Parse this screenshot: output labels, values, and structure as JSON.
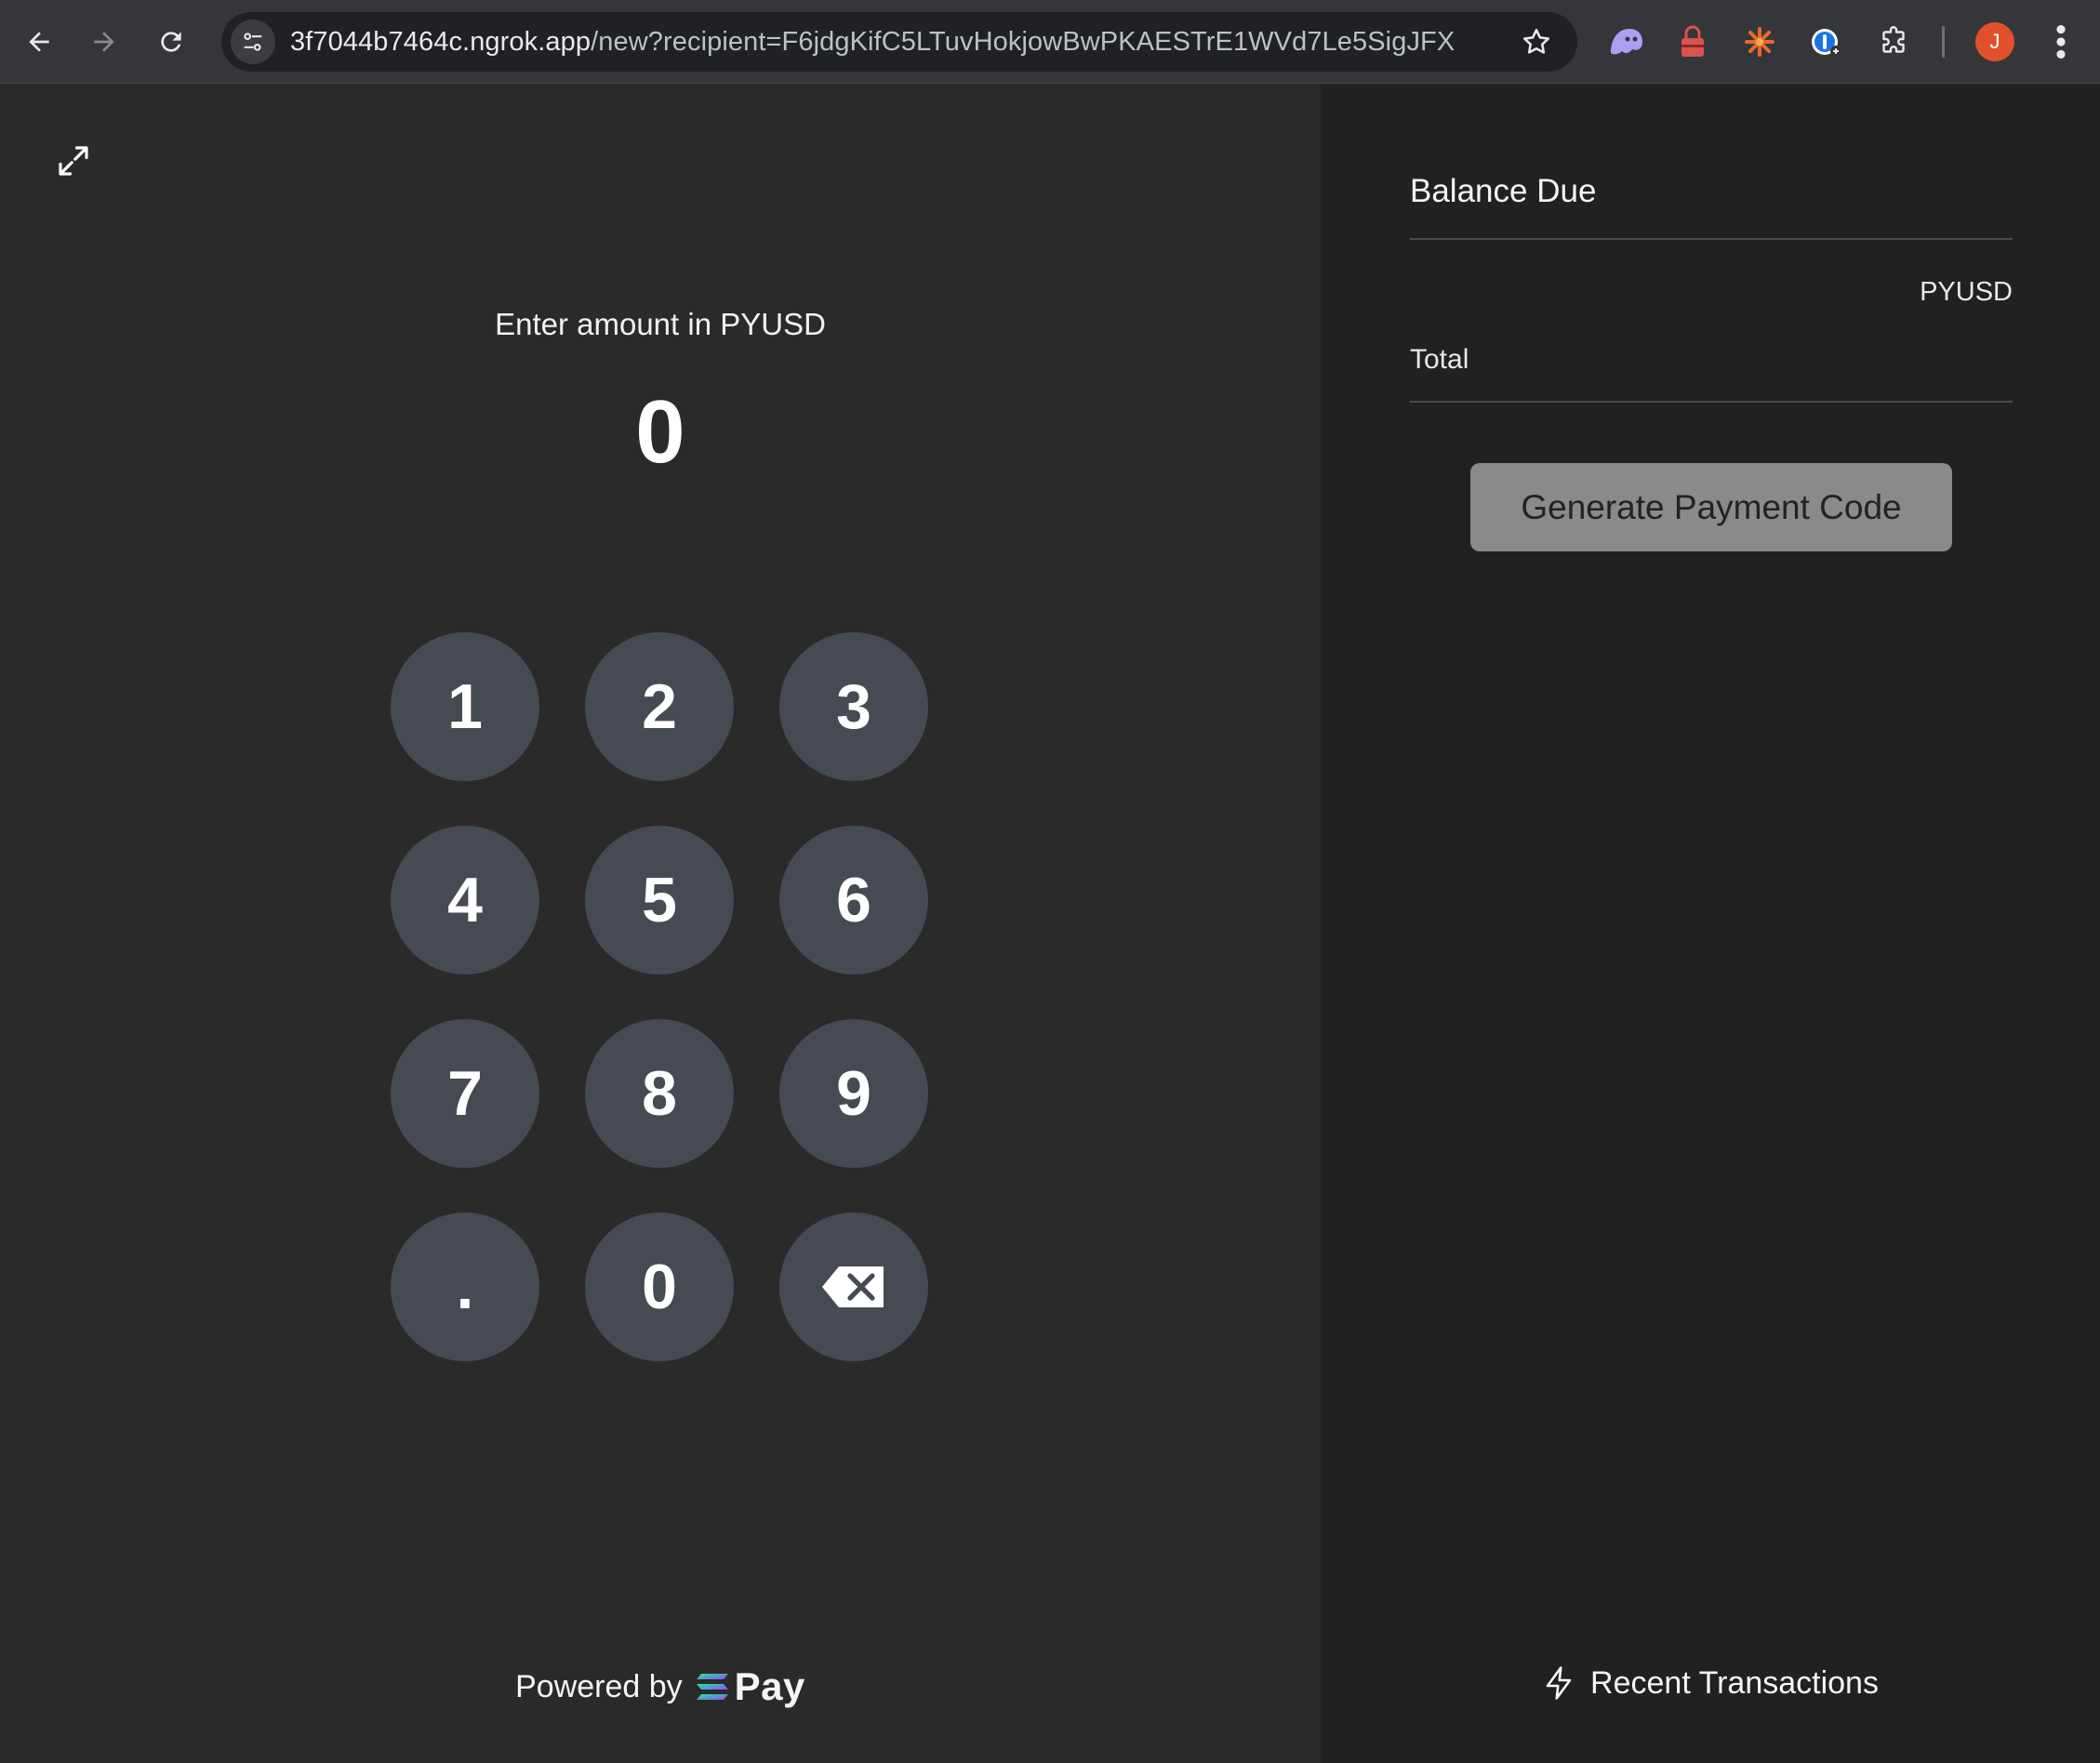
{
  "browser": {
    "url_host": "3f7044b7464c.ngrok.app",
    "url_path": "/new?recipient=F6jdgKifC5LTuvHokjowBwPKAESTrE1WVd7Le5SigJFX",
    "profile_initial": "J"
  },
  "terminal": {
    "prompt": "Enter amount in PYUSD",
    "amount": "0",
    "keys": [
      {
        "label": "1"
      },
      {
        "label": "2"
      },
      {
        "label": "3"
      },
      {
        "label": "4"
      },
      {
        "label": "5"
      },
      {
        "label": "6"
      },
      {
        "label": "7"
      },
      {
        "label": "8"
      },
      {
        "label": "9"
      },
      {
        "label": "."
      },
      {
        "label": "0"
      },
      {
        "label": "",
        "icon": "backspace-icon"
      }
    ],
    "powered_by": "Powered by",
    "pay_logo_text": "Pay"
  },
  "summary": {
    "title": "Balance Due",
    "currency": "PYUSD",
    "total_label": "Total",
    "generate_label": "Generate Payment Code",
    "recent_label": "Recent Transactions"
  },
  "colors": {
    "left_bg": "#2a2a2a",
    "right_bg": "#212121",
    "key_bg": "#464a52",
    "button_bg": "#8a8a8a",
    "profile": "#e0502d"
  }
}
